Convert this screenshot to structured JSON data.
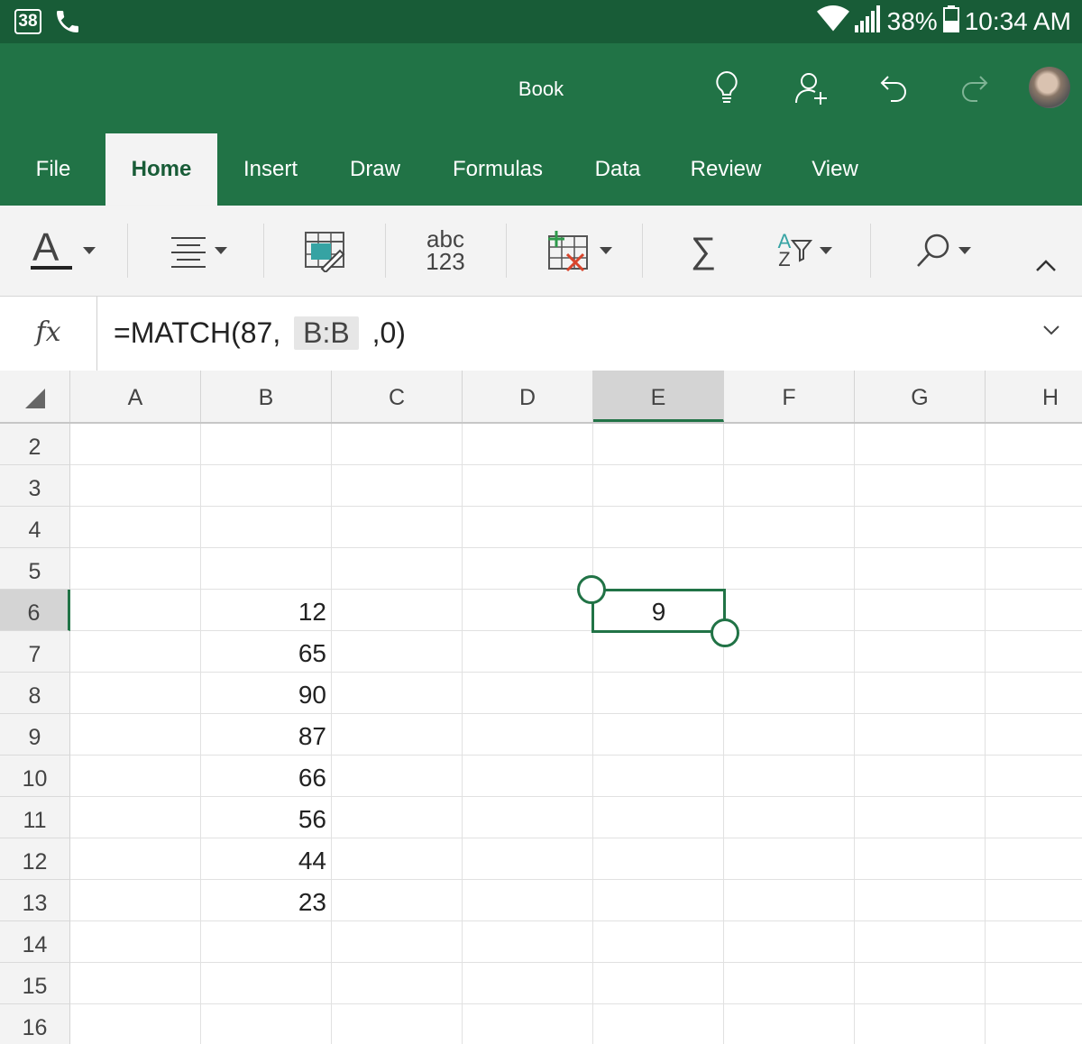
{
  "status_bar": {
    "notification_count": "38",
    "battery": "38%",
    "time": "10:34 AM",
    "icons": [
      "phone-icon",
      "wifi-icon",
      "signal-icon",
      "battery-icon"
    ]
  },
  "titlebar": {
    "title": "Book",
    "icons": [
      "lightbulb-icon",
      "share-person-icon",
      "undo-icon",
      "redo-icon",
      "avatar"
    ]
  },
  "tabs": [
    "File",
    "Home",
    "Insert",
    "Draw",
    "Formulas",
    "Data",
    "Review",
    "View"
  ],
  "active_tab": "Home",
  "ribbon": {
    "number_format_top": "abc",
    "number_format_bottom": "123",
    "sum_symbol": "∑",
    "sort_top": "A",
    "sort_bottom": "Z",
    "icons": [
      "font-color-icon",
      "align-icon",
      "cell-styles-icon",
      "number-format-icon",
      "insert-delete-icon",
      "autosum-icon",
      "sort-filter-icon",
      "find-icon",
      "collapse-ribbon-icon"
    ]
  },
  "formula_bar": {
    "fx_label": "fx",
    "formula_prefix": "=MATCH(87, ",
    "formula_ref": "B:B",
    "formula_suffix": " ,0)"
  },
  "columns": [
    "A",
    "B",
    "C",
    "D",
    "E",
    "F",
    "G",
    "H"
  ],
  "selected_column": "E",
  "rows": [
    2,
    3,
    4,
    5,
    6,
    7,
    8,
    9,
    10,
    11,
    12,
    13,
    14,
    15,
    16
  ],
  "selected_row": 6,
  "cells": {
    "B6": "12",
    "B7": "65",
    "B8": "90",
    "B9": "87",
    "B10": "66",
    "B11": "56",
    "B12": "44",
    "B13": "23",
    "E6": "9"
  },
  "colors": {
    "status_bar": "#185c37",
    "excel_green": "#217346",
    "ribbon_bg": "#f3f3f3"
  }
}
